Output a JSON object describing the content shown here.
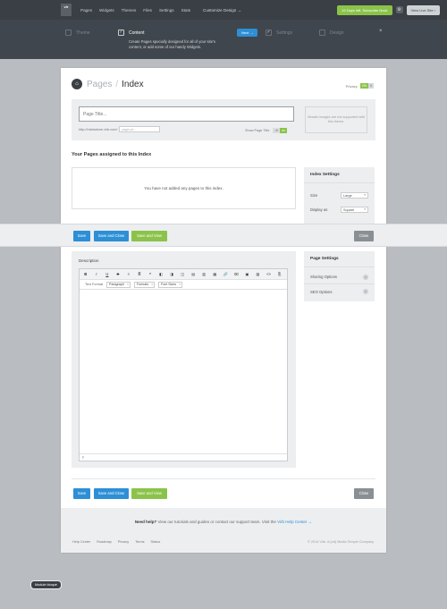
{
  "topnav": {
    "logo": "vir",
    "items": [
      "Pages",
      "Widgets",
      "Themes",
      "Files",
      "Settings",
      "Stats"
    ],
    "customize": "Customize Design →",
    "trial_button": "19 Days left. Subscribe Now!",
    "live_button": "View Live Site ›"
  },
  "wizard": {
    "steps": [
      {
        "label": "Theme",
        "active": false
      },
      {
        "label": "Content",
        "active": true
      },
      {
        "label": "Settings",
        "active": false
      },
      {
        "label": "Design",
        "active": false
      }
    ],
    "description": "Create Pages specially designed for all of your site's content, or add some of our handy Widgets.",
    "next_button": "Next →",
    "close_icon": "×"
  },
  "page": {
    "crumb_parent": "Pages",
    "crumb_sep": "/",
    "crumb_current": "Index",
    "privacy_label": "Privacy",
    "privacy_on": "ON",
    "privacy_off": "0"
  },
  "title_area": {
    "title_placeholder": "Page Title...",
    "url_prefix": "http://mieladone.virb.com/",
    "url_placeholder": "page-url...",
    "show_title_label": "Show Page Title",
    "toggle_off": "off",
    "toggle_on": "on",
    "header_note": "Header images are not supported with this theme."
  },
  "assigned": {
    "title": "Your Pages assigned to this Index",
    "empty_message": "You have not added any pages to this index."
  },
  "index_settings": {
    "title": "Index Settings",
    "rows": [
      {
        "label": "Size",
        "value": "Large"
      },
      {
        "label": "Display as",
        "value": "Square"
      }
    ]
  },
  "actions": {
    "save": "Save",
    "save_close": "Save and Close",
    "save_view": "Save and View",
    "close": "Close"
  },
  "description": {
    "label": "Description",
    "toolbar_icons": [
      "B",
      "I",
      "U",
      "S",
      "≡",
      "≣",
      "❝",
      "◧",
      "◨",
      "◫",
      "▤",
      "▥",
      "▦",
      "🔗",
      "⌧",
      "▣",
      "▨",
      "<>",
      "⎘"
    ],
    "text_format_label": "Text Format",
    "paragraph": "Paragraph",
    "formats": "Formats",
    "font_sizes": "Font Sizes",
    "status": "p"
  },
  "page_settings": {
    "title": "Page Settings",
    "rows": [
      "Sharing Options",
      "SEO Options"
    ]
  },
  "help": {
    "need_help": "Need help?",
    "text": "View our tutorials and guides or contact our support team. Visit the",
    "link": "Virb Help Center →"
  },
  "footer": {
    "links": [
      "Help Center",
      "Roadmap",
      "Privacy",
      "Terms",
      "Status"
    ],
    "copyright": "© 2014 Virb. A (mt) Media Temple Company"
  },
  "module_badge": "Module bloqué"
}
